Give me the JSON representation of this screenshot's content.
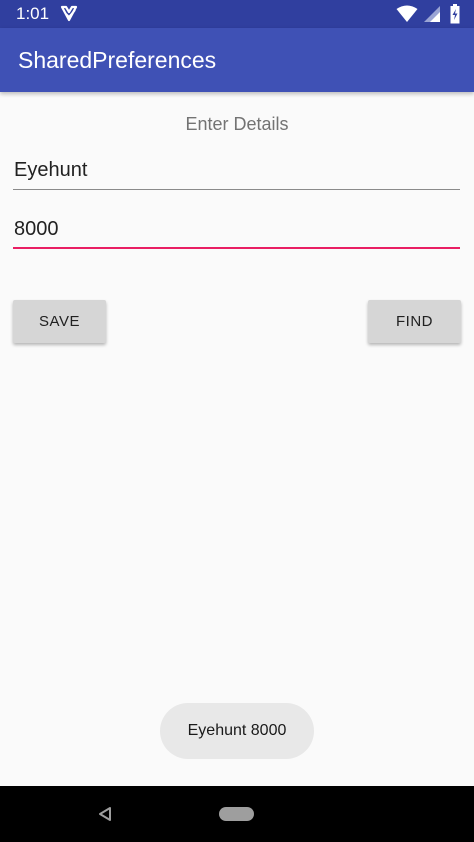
{
  "status_bar": {
    "time": "1:01",
    "app_icon": "check-notification-icon",
    "wifi_icon": "wifi-icon",
    "signal_icon": "cell-signal-icon",
    "battery_icon": "battery-charging-icon"
  },
  "app_bar": {
    "title": "SharedPreferences",
    "color": "#3f51b5",
    "status_color": "#303f9f"
  },
  "form": {
    "heading": "Enter Details",
    "name_value": "Eyehunt",
    "number_value": "8000",
    "accent_color": "#e91e63"
  },
  "buttons": {
    "save_label": "SAVE",
    "find_label": "FIND"
  },
  "toast": {
    "message": "Eyehunt 8000"
  },
  "nav_bar": {
    "back_icon": "back-triangle-icon",
    "home_icon": "home-pill-icon"
  }
}
